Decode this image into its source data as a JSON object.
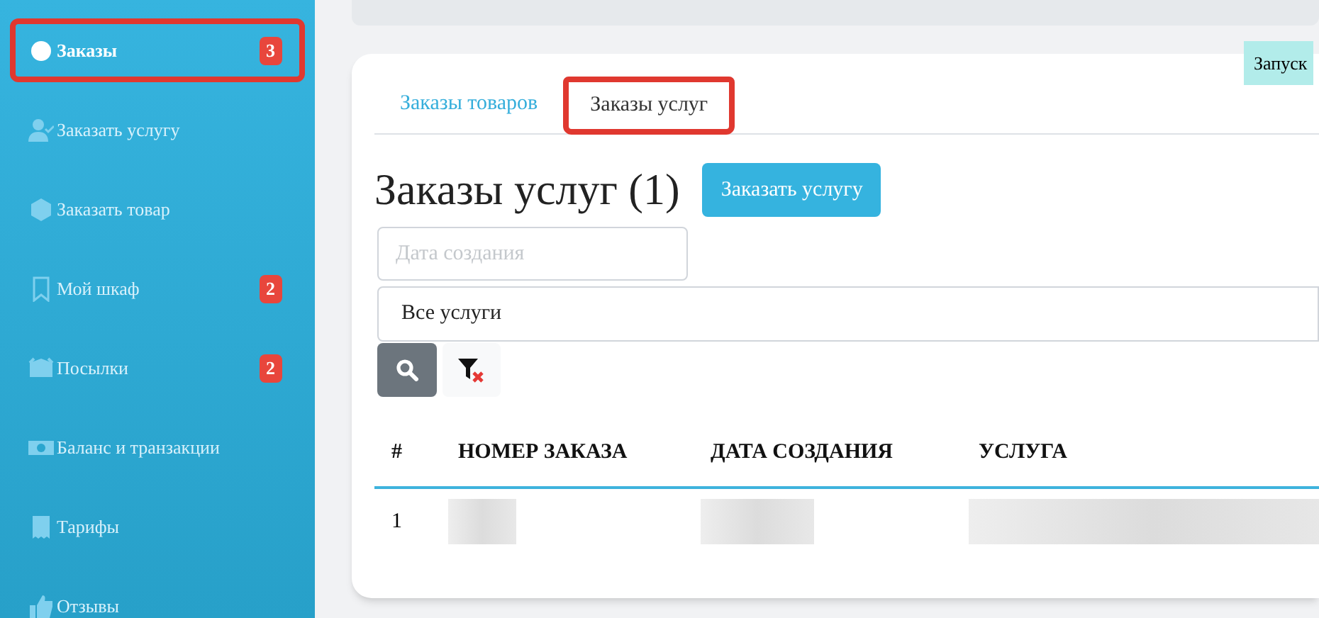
{
  "sidebar": {
    "items": [
      {
        "label": "Заказы",
        "selected": true,
        "highlighted": true,
        "badge": "3"
      },
      {
        "label": "Заказать услугу",
        "selected": false,
        "highlighted": false
      },
      {
        "label": "Заказать товар",
        "selected": false,
        "highlighted": false
      },
      {
        "label": "Мой шкаф",
        "selected": false,
        "highlighted": false,
        "badge": "2"
      },
      {
        "label": "Посылки",
        "selected": false,
        "highlighted": false,
        "badge": "2"
      },
      {
        "label": "Баланс и транзакции",
        "selected": false,
        "highlighted": false
      },
      {
        "label": "Тарифы",
        "selected": false,
        "highlighted": false
      },
      {
        "label": "Отзывы",
        "selected": false,
        "highlighted": false
      }
    ]
  },
  "launch_chip": "Запуск",
  "tabs": [
    {
      "label": "Заказы товаров",
      "selected": false,
      "highlighted": false
    },
    {
      "label": "Заказы услуг",
      "selected": true,
      "highlighted": true
    }
  ],
  "heading": "Заказы услуг (1)",
  "order_button": "Заказать услугу",
  "filters": {
    "date": {
      "placeholder": "Дата создания"
    },
    "service": {
      "value": "Все услуги"
    }
  },
  "table": {
    "columns": [
      "#",
      "НОМЕР ЗАКАЗА",
      "ДАТА СОЗДАНИЯ",
      "УСЛУГА"
    ],
    "rows": [
      {
        "number": "1",
        "cells": [
          {
            "kind": "redacted"
          },
          {
            "kind": "redacted"
          },
          {
            "kind": "redacted"
          }
        ]
      }
    ]
  }
}
